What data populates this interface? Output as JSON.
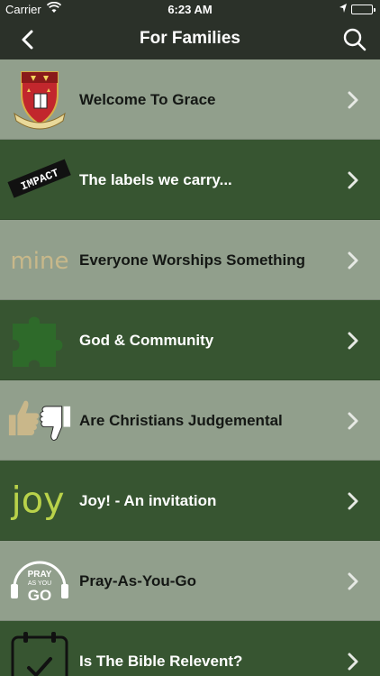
{
  "status_bar": {
    "carrier": "Carrier",
    "time": "6:23 AM"
  },
  "nav": {
    "title": "For Families",
    "back_icon": "chevron-left-icon",
    "search_icon": "search-icon"
  },
  "items": [
    {
      "label": "Welcome To Grace",
      "icon": "crest-icon",
      "style": "light"
    },
    {
      "label": "The labels we carry...",
      "icon": "impact-label-icon",
      "style": "dark",
      "icon_text": "IMPACT"
    },
    {
      "label": "Everyone Worships Something",
      "icon": "mine-text-icon",
      "style": "light",
      "icon_text": "mine"
    },
    {
      "label": "God & Community",
      "icon": "puzzle-piece-icon",
      "style": "dark"
    },
    {
      "label": "Are Christians Judgemental",
      "icon": "thumbs-up-down-icon",
      "style": "light"
    },
    {
      "label": "Joy! - An invitation",
      "icon": "joy-text-icon",
      "style": "dark",
      "icon_text": "joy"
    },
    {
      "label": "Pray-As-You-Go",
      "icon": "pray-as-you-go-logo-icon",
      "style": "light",
      "icon_text": [
        "PRAY",
        "AS YOU",
        "GO"
      ]
    },
    {
      "label": "Is The Bible Relevent?",
      "icon": "calendar-check-icon",
      "style": "dark"
    }
  ],
  "colors": {
    "bar": "#2b3129",
    "row_light": "#adbda8",
    "row_dark": "#385832",
    "joy_green": "#b9d24a",
    "puzzle_green": "#2e6a2a",
    "mine_tan": "#c8b88a"
  }
}
